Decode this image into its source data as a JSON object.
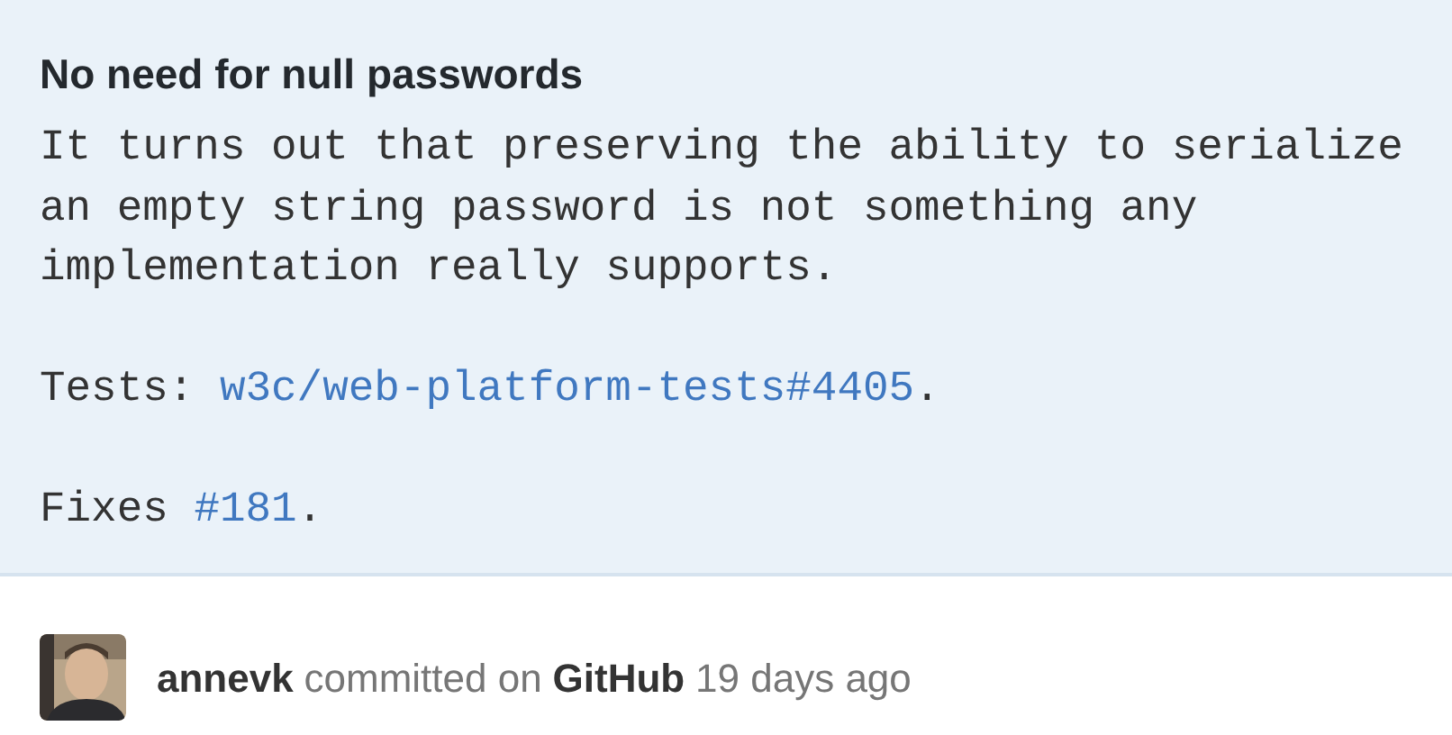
{
  "commit": {
    "title": "No need for null passwords",
    "message": [
      {
        "lines": [
          "It turns out that preserving the ability to serialize",
          "an empty string password is not something any",
          "implementation really supports."
        ]
      },
      {
        "segments": [
          {
            "kind": "text",
            "text": "Tests: "
          },
          {
            "kind": "link",
            "text": "w3c/web-platform-tests#4405"
          },
          {
            "kind": "text",
            "text": "."
          }
        ]
      },
      {
        "segments": [
          {
            "kind": "text",
            "text": "Fixes "
          },
          {
            "kind": "link",
            "text": "#181"
          },
          {
            "kind": "text",
            "text": "."
          }
        ]
      }
    ]
  },
  "footer": {
    "author": "annevk",
    "action": "committed on",
    "platform": "GitHub",
    "time": "19 days ago"
  }
}
